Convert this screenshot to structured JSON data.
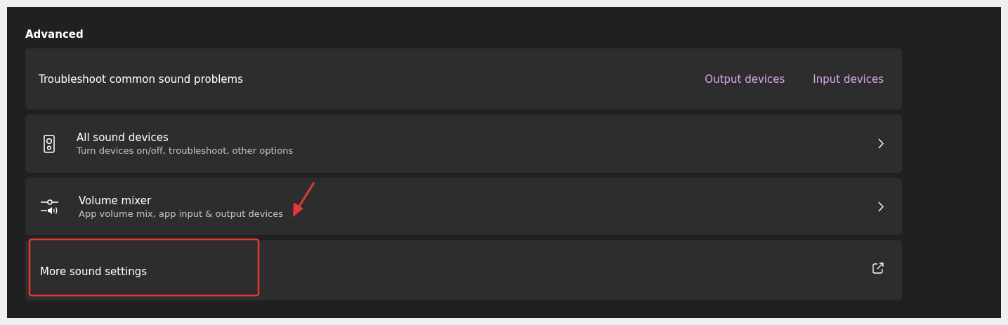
{
  "section": {
    "title": "Advanced"
  },
  "rows": [
    {
      "kind": "links",
      "label": "Troubleshoot common sound problems",
      "links": [
        "Output devices",
        "Input devices"
      ],
      "highlighted": false
    },
    {
      "kind": "nav",
      "label": "All sound devices",
      "description": "Turn devices on/off, troubleshoot, other options",
      "highlighted": false
    },
    {
      "kind": "nav",
      "label": "Volume mixer",
      "description": "App volume mix, app input & output devices",
      "highlighted": false
    },
    {
      "kind": "external",
      "label": "More sound settings",
      "highlighted": true
    }
  ]
}
